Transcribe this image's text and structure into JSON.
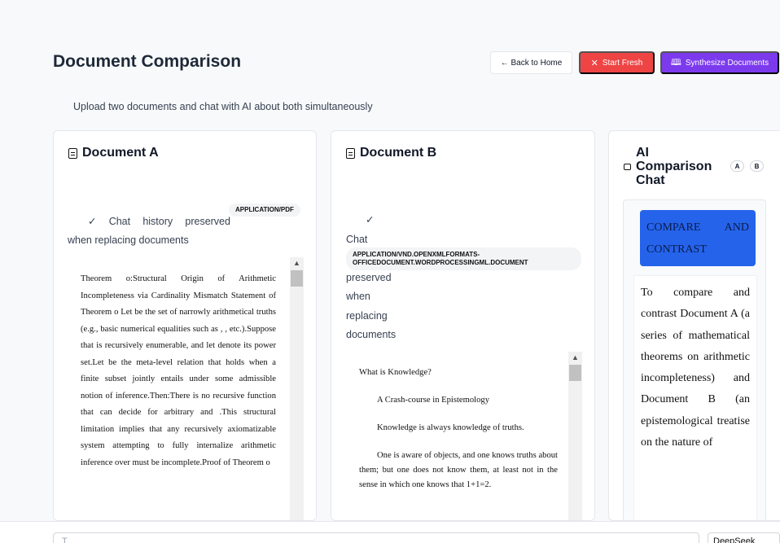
{
  "header": {
    "title": "Document Comparison",
    "subtitle": "Upload two documents and chat with AI about both simultaneously",
    "back_label": "← Back to Home",
    "fresh_label": "Start Fresh",
    "synth_label": "Synthesize Documents",
    "fresh_icon": "✕",
    "synth_icon": "🕮"
  },
  "colors": {
    "fresh": "#ef4444",
    "synth": "#7c3aed",
    "user_msg": "#2563eb"
  },
  "doc_a": {
    "title": "Document A",
    "check": "✓",
    "status_words": [
      "Chat",
      "history",
      "preserved"
    ],
    "status_line2": "when replacing documents",
    "mime": "APPLICATION/PDF",
    "text": "Theorem o:Structural Origin of Arithmetic Incompleteness via Cardinality Mismatch Statement of Theorem o Let be the set of narrowly arithmetical truths (e.g., basic numerical equalities such as , , etc.).Suppose that is recursively enumerable, and let denote its power set.Let be the meta-level relation that holds when a finite subset jointly entails under some admissible notion of inference.Then:There is no recursive function that can decide for arbitrary and .This structural limitation implies that any recursively axiomatizable system attempting to fully internalize arithmetic inference over must be incomplete.Proof of Theorem o"
  },
  "doc_b": {
    "title": "Document B",
    "check": "✓",
    "status_lines": [
      "Chat",
      "preserved",
      "when",
      "replacing",
      "documents"
    ],
    "mime": "APPLICATION/VND.OPENXMLFORMATS-OFFICEDOCUMENT.WORDPROCESSINGML.DOCUMENT",
    "paragraphs": [
      "What is Knowledge?",
      "A Crash-course in Epistemology",
      "Knowledge is always knowledge of truths.",
      "One is aware of objects, and one knows truths about them; but one does not know them, at least not in the sense in which one knows that 1+1=2."
    ]
  },
  "chat": {
    "title": "AI Comparison Chat",
    "pill_a": "A",
    "pill_b": "B",
    "user_message": "COMPARE AND CONTRAST",
    "ai_message": "To compare and contrast Document A (a series of mathematical theorems on arithmetic incompleteness) and Document B (an epistemological treatise on the nature of",
    "input_placeholder": "T",
    "model": "DeepSeek"
  }
}
